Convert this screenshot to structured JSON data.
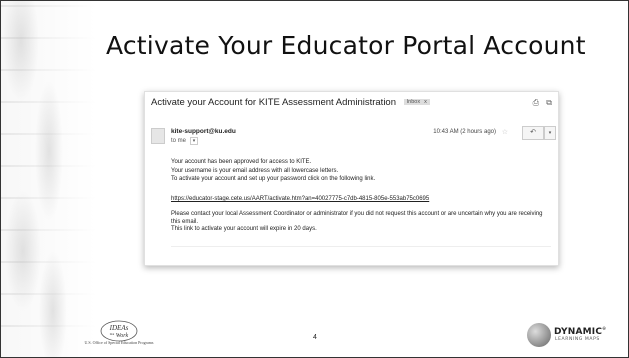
{
  "slide": {
    "title": "Activate Your Educator Portal Account",
    "page_number": "4"
  },
  "email": {
    "subject": "Activate your Account for KITE Assessment Administration",
    "inbox_tag": "Inbox",
    "inbox_tag_close": "x",
    "sender": "kite-support@ku.edu",
    "to_me": "to me",
    "timestamp": "10:43 AM (2 hours ago)",
    "body_lines": [
      "Your account has been approved for access to KITE.",
      "Your username is your email address with all lowercase letters.",
      "To activate your account and set up your password click on the following link."
    ],
    "link": "https://educator-stage.cete.us/AART/activate.htm?an=40027775-c7db-4815-805e-553ab75c0695",
    "body_lines_2": [
      "Please contact your local Assessment Coordinator or administrator if you did not request this account or are uncertain why you are receiving",
      "this email.",
      "This link to activate your account will expire in 20 days."
    ]
  },
  "logos": {
    "ideas": "IDEAs that Work",
    "ideas_caption": "U.S. Office of Special Education Programs",
    "dlm_word": "DYNAMIC",
    "dlm_reg": "®",
    "dlm_sub": "LEARNING MAPS"
  },
  "icons": {
    "print": "print-icon",
    "popout": "popout-icon",
    "star": "star-icon",
    "reply": "reply-icon",
    "more": "more-dropdown-icon"
  }
}
